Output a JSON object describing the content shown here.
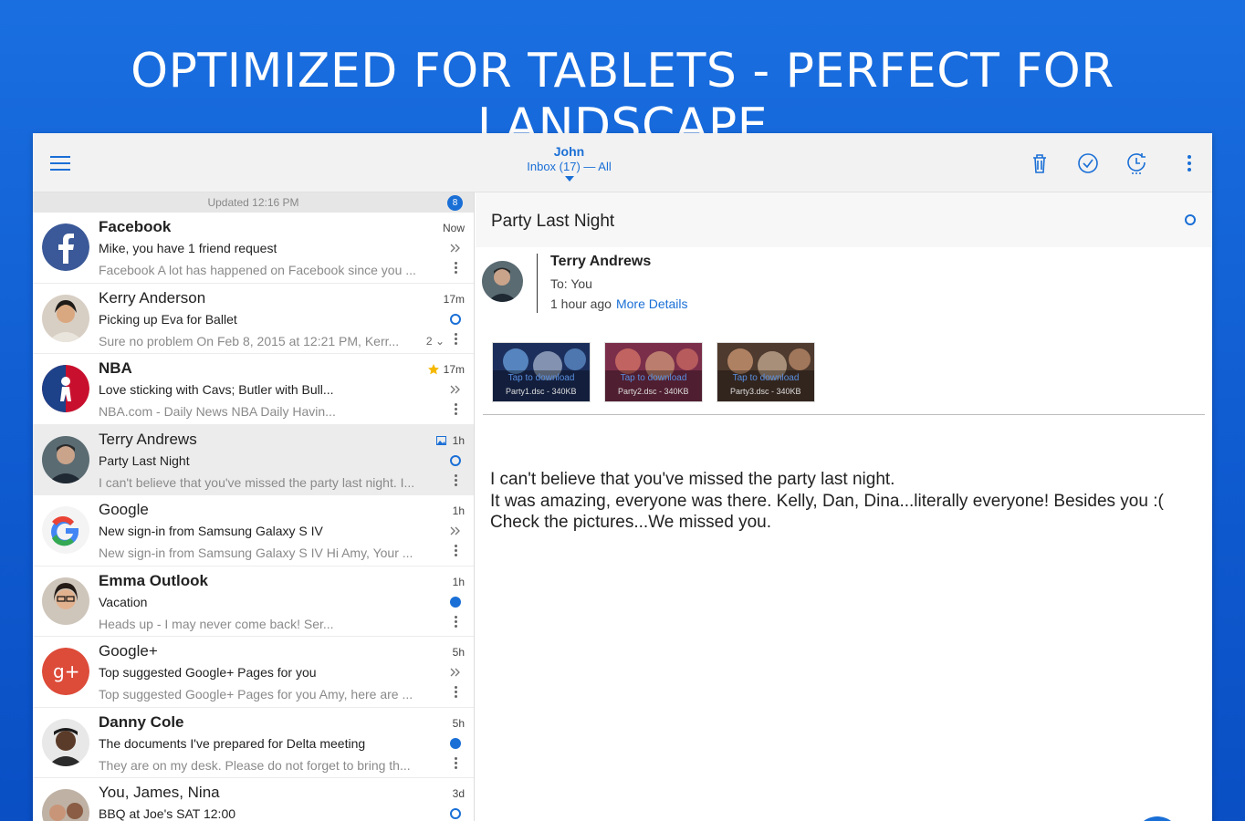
{
  "headline": "OPTIMIZED FOR TABLETS - PERFECT FOR LANDSCAPE",
  "topbar": {
    "account_name": "John",
    "inbox_label": "Inbox (17) — All"
  },
  "list": {
    "updated_label": "Updated 12:16 PM",
    "updated_count": "8",
    "items": [
      {
        "sender": "Facebook",
        "subject": "Mike, you have 1 friend request",
        "preview": "Facebook A lot has happened on Facebook since you ...",
        "time": "Now",
        "status": "chevrons",
        "bold": true
      },
      {
        "sender": "Kerry Anderson",
        "subject": "Picking up Eva for Ballet",
        "preview": "Sure no problem On Feb 8, 2015 at 12:21 PM, Kerr...",
        "time": "17m",
        "status": "open",
        "thread": "2",
        "bold": false
      },
      {
        "sender": "NBA",
        "subject": "Love sticking with Cavs; Butler with Bull...",
        "preview": "NBA.com - Daily News NBA Daily Havin...",
        "time": "17m",
        "status": "chevrons",
        "bold": true
      },
      {
        "sender": "Terry Andrews",
        "subject": "Party Last Night",
        "preview": "I can't believe that you've missed the party last night. I...",
        "time": "1h",
        "status": "open",
        "bold": false
      },
      {
        "sender": "Google",
        "subject": "New sign-in from Samsung Galaxy S IV",
        "preview": "New sign-in from Samsung Galaxy S IV Hi Amy, Your ...",
        "time": "1h",
        "status": "chevrons",
        "bold": false
      },
      {
        "sender": "Emma Outlook",
        "subject": "Vacation",
        "preview": "Heads up - I may never come back! Ser...",
        "time": "1h",
        "status": "filled",
        "bold": true
      },
      {
        "sender": "Google+",
        "subject": "Top suggested Google+ Pages for you",
        "preview": "Top suggested Google+ Pages for you Amy, here are ...",
        "time": "5h",
        "status": "chevrons",
        "bold": false
      },
      {
        "sender": "Danny Cole",
        "subject": "The documents I've prepared for Delta meeting",
        "preview": "They are on my desk. Please do not forget to bring th...",
        "time": "5h",
        "status": "filled",
        "bold": true
      },
      {
        "sender": "You, James, Nina",
        "subject": "BBQ at Joe's SAT 12:00",
        "preview": "",
        "time": "3d",
        "status": "open",
        "bold": false
      }
    ]
  },
  "reader": {
    "subject": "Party Last Night",
    "from": "Terry Andrews",
    "to": "To: You",
    "ago": "1 hour ago",
    "more_details": "More Details",
    "attachments": [
      {
        "tap": "Tap to download",
        "name": "Party1.dsc - 340KB"
      },
      {
        "tap": "Tap to download",
        "name": "Party2.dsc - 340KB"
      },
      {
        "tap": "Tap to download",
        "name": "Party3.dsc - 340KB"
      }
    ],
    "body": [
      "I can't believe that you've missed the party last night.",
      "It was amazing, everyone was there. Kelly, Dan, Dina...literally everyone! Besides you :(",
      "Check the pictures...We missed you."
    ]
  },
  "colors": {
    "accent": "#1a6fd6",
    "background": "#1565d8"
  }
}
